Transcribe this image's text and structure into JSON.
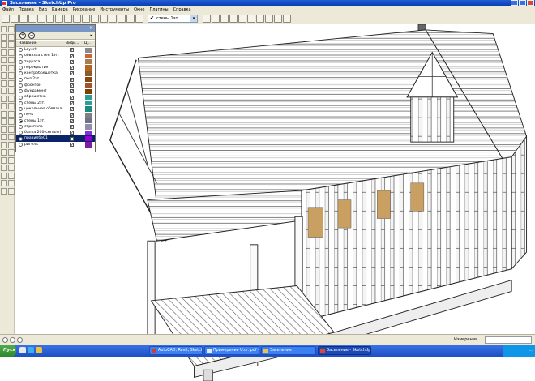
{
  "window": {
    "title": "Заселение - SketchUp Pro"
  },
  "menu": {
    "items": [
      "Файл",
      "Правка",
      "Вид",
      "Камера",
      "Рисование",
      "Инструменты",
      "Окно",
      "Плагины",
      "Справка"
    ]
  },
  "toolbar": {
    "current_layer": "стены 1эт",
    "current_layer_check": "✔",
    "dropdown_arrow": "▾"
  },
  "layers_panel": {
    "close_glyph": "×",
    "add_glyph": "+",
    "remove_glyph": "−",
    "menu_arrow": "▸",
    "col_name": "Название",
    "col_visible": "Види...",
    "col_color": "Ц...",
    "layers": [
      {
        "name": "Layer0",
        "active": false,
        "visible": true,
        "color": "#8a8a8a"
      },
      {
        "name": "обвязка стен 1эт.",
        "active": false,
        "visible": true,
        "color": "#c8683a"
      },
      {
        "name": "терраса",
        "active": false,
        "visible": true,
        "color": "#a67c52"
      },
      {
        "name": "перекрытие",
        "active": false,
        "visible": true,
        "color": "#b5651d"
      },
      {
        "name": "контробрешетка",
        "active": false,
        "visible": true,
        "color": "#8b5a2b"
      },
      {
        "name": "пол 2эт.",
        "active": false,
        "visible": true,
        "color": "#8b4513"
      },
      {
        "name": "фронтон",
        "active": false,
        "visible": true,
        "color": "#a0522d"
      },
      {
        "name": "фундамент",
        "active": false,
        "visible": true,
        "color": "#7b3f00"
      },
      {
        "name": "обрешетка",
        "active": false,
        "visible": true,
        "color": "#2e9c8f"
      },
      {
        "name": "стены 2эт.",
        "active": false,
        "visible": true,
        "color": "#2aa198"
      },
      {
        "name": "цокольная обвязка",
        "active": false,
        "visible": true,
        "color": "#1b8a80"
      },
      {
        "name": "печь",
        "active": false,
        "visible": true,
        "color": "#808080"
      },
      {
        "name": "стены 1эт.",
        "active": true,
        "visible": true,
        "color": "#6f6f8f"
      },
      {
        "name": "стропила",
        "active": false,
        "visible": true,
        "color": "#8f8fa8"
      },
      {
        "name": "балка 200(смпалт)",
        "active": false,
        "visible": true,
        "color": "#8a2be2"
      },
      {
        "name": "правилбе01",
        "active": false,
        "visible": true,
        "color": "#9400d3",
        "selected": true
      },
      {
        "name": "ригель",
        "active": false,
        "visible": true,
        "color": "#7b1fa2"
      }
    ]
  },
  "status": {
    "measure_label": "Измерения"
  },
  "taskbar": {
    "start_label": "Пуск",
    "tasks": [
      {
        "label": "AutoCAD, Revit, Sketch...",
        "active": false,
        "color": "#d83a2a"
      },
      {
        "label": "Примерение U.dr. pdf - A...",
        "active": false,
        "color": "#e8e8e8"
      },
      {
        "label": "Заселение",
        "active": false,
        "color": "#f0c040"
      },
      {
        "label": "Заселение - SketchUp...",
        "active": true,
        "color": "#d84a2a"
      }
    ],
    "clock": "..."
  },
  "colors": {
    "titlebar": "#0a3aa8",
    "chrome": "#ece9d8",
    "selection": "#0a246a",
    "osb_panel": "#c9a061"
  }
}
